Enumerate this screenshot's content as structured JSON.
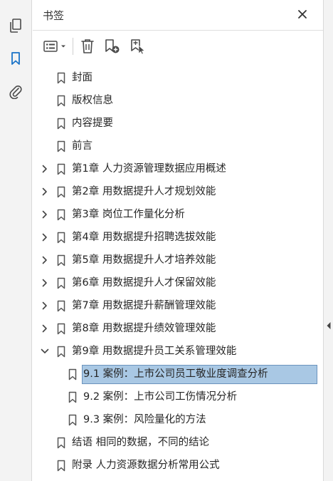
{
  "panel": {
    "title": "书签"
  },
  "rail": {
    "items": [
      {
        "name": "pages-icon"
      },
      {
        "name": "bookmarks-icon"
      },
      {
        "name": "attachments-icon"
      }
    ]
  },
  "bookmarks": [
    {
      "label": "封面",
      "level": 0,
      "expander": "none"
    },
    {
      "label": "版权信息",
      "level": 0,
      "expander": "none"
    },
    {
      "label": "内容提要",
      "level": 0,
      "expander": "none"
    },
    {
      "label": "前言",
      "level": 0,
      "expander": "none"
    },
    {
      "label": "第1章 人力资源管理数据应用概述",
      "level": 0,
      "expander": "collapsed"
    },
    {
      "label": "第2章 用数据提升人才规划效能",
      "level": 0,
      "expander": "collapsed"
    },
    {
      "label": "第3章 岗位工作量化分析",
      "level": 0,
      "expander": "collapsed"
    },
    {
      "label": "第4章 用数据提升招聘选拔效能",
      "level": 0,
      "expander": "collapsed"
    },
    {
      "label": "第5章 用数据提升人才培养效能",
      "level": 0,
      "expander": "collapsed"
    },
    {
      "label": "第6章 用数据提升人才保留效能",
      "level": 0,
      "expander": "collapsed"
    },
    {
      "label": "第7章 用数据提升薪酬管理效能",
      "level": 0,
      "expander": "collapsed"
    },
    {
      "label": "第8章 用数据提升绩效管理效能",
      "level": 0,
      "expander": "collapsed"
    },
    {
      "label": "第9章 用数据提升员工关系管理效能",
      "level": 0,
      "expander": "expanded"
    },
    {
      "label": "9.1 案例：上市公司员工敬业度调查分析",
      "level": 1,
      "expander": "none",
      "selected": true
    },
    {
      "label": "9.2 案例：上市公司工伤情况分析",
      "level": 1,
      "expander": "none"
    },
    {
      "label": "9.3 案例：风险量化的方法",
      "level": 1,
      "expander": "none"
    },
    {
      "label": "结语 相同的数据，不同的结论",
      "level": 0,
      "expander": "none"
    },
    {
      "label": "附录 人力资源数据分析常用公式",
      "level": 0,
      "expander": "none"
    }
  ],
  "colors": {
    "selection_fill": "#a9c8e4",
    "selection_border": "#6b93bd",
    "active_icon": "#1a73c7",
    "icon_gray": "#4a4a4a"
  }
}
